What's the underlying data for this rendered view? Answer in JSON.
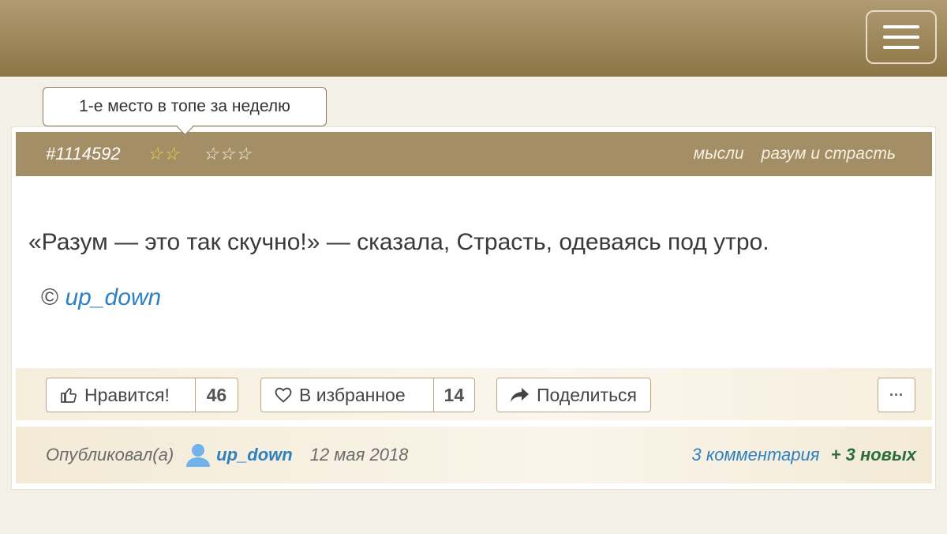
{
  "header": {
    "menu_icon": "hamburger-icon"
  },
  "tooltip": {
    "text": "1-е место в топе за неделю"
  },
  "quote": {
    "id": "#1114592",
    "stars_filled": "☆☆",
    "stars_empty": "☆☆☆",
    "tags": [
      "мысли",
      "разум и страсть"
    ],
    "text": "«Разум — это так скучно!» — сказала, Страсть, одеваясь под утро.",
    "copyright_symbol": "©",
    "attribution": "up_down"
  },
  "actions": {
    "like_label": "Нравится!",
    "like_count": "46",
    "fav_label": "В избранное",
    "fav_count": "14",
    "share_label": "Поделиться",
    "more_label": "···"
  },
  "footer": {
    "published_label": "Опубликовал(а)",
    "author": "up_down",
    "date": "12 мая 2018",
    "comments": "3 комментария",
    "new": "+ 3 новых"
  },
  "colors": {
    "header_bg": "#a38e66",
    "topbar": "#9c875b",
    "link": "#2f80c0",
    "new_badge": "#2b6e3a",
    "star_on": "#f2d44a"
  }
}
